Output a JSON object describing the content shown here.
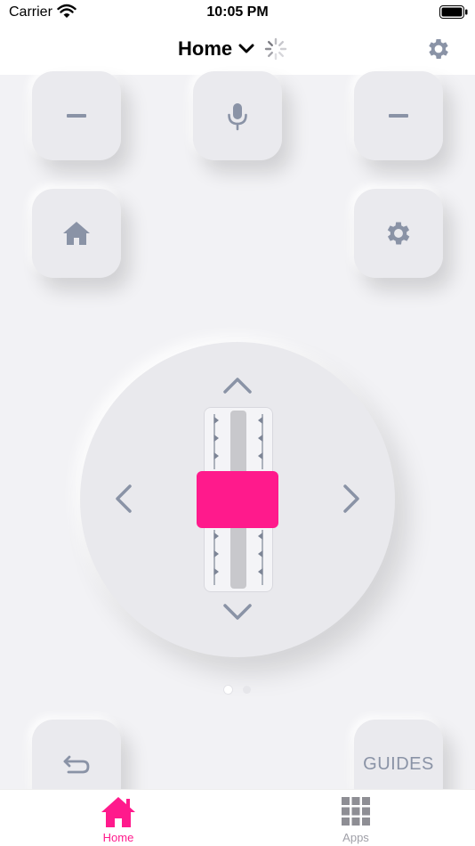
{
  "status_bar": {
    "carrier": "Carrier",
    "time": "10:05 PM"
  },
  "nav": {
    "title": "Home"
  },
  "remote": {
    "buttons": {
      "volume_down_left": {
        "icon": "minus-icon"
      },
      "voice": {
        "icon": "microphone-icon"
      },
      "volume_down_right": {
        "icon": "minus-icon"
      },
      "home": {
        "icon": "house-icon"
      },
      "settings": {
        "icon": "gear-icon"
      },
      "back": {
        "icon": "return-arrow-icon"
      },
      "guides": {
        "label": "GUIDES"
      }
    },
    "slider_level": 0.5
  },
  "pager": {
    "pages": 2,
    "current": 1
  },
  "tabs": [
    {
      "label": "Home",
      "icon": "house-icon",
      "active": true
    },
    {
      "label": "Apps",
      "icon": "grid-icon",
      "active": false
    }
  ],
  "colors": {
    "accent": "#ff1a8c",
    "icon_gray": "#8a93a6",
    "button_bg": "#eaeaee"
  }
}
